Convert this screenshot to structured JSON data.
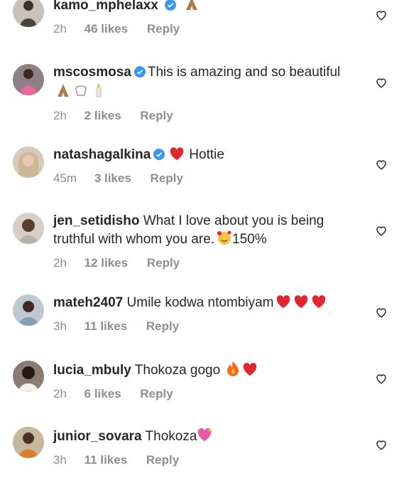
{
  "comments": [
    {
      "username": "kamo_mphelaxx",
      "verified": true,
      "text": "",
      "emoji": [
        "folded-hands"
      ],
      "time": "2h",
      "likes": "46 likes",
      "reply": "Reply"
    },
    {
      "username": "mscosmosa",
      "verified": true,
      "text": "This is amazing and so beautiful",
      "emoji": [
        "folded-hands",
        "pouch",
        "candle"
      ],
      "time": "2h",
      "likes": "2 likes",
      "reply": "Reply"
    },
    {
      "username": "natashagalkina",
      "verified": true,
      "text": "Hottie",
      "emoji": [
        "red-heart"
      ],
      "time": "45m",
      "likes": "3 likes",
      "reply": "Reply"
    },
    {
      "username": "jen_setidisho",
      "verified": false,
      "text": "What I love about you is being truthful with whom you are.",
      "text_tail": "150%",
      "emoji": [
        "smiling-face-with-hearts"
      ],
      "time": "2h",
      "likes": "12 likes",
      "reply": "Reply"
    },
    {
      "username": "mateh2407",
      "verified": false,
      "text": "Umile kodwa ntombiyam",
      "emoji": [
        "red-heart",
        "red-heart",
        "red-heart"
      ],
      "time": "3h",
      "likes": "11 likes",
      "reply": "Reply"
    },
    {
      "username": "lucia_mbuly",
      "verified": false,
      "text": "Thokoza gogo",
      "emoji": [
        "fire",
        "red-heart"
      ],
      "time": "2h",
      "likes": "6 likes",
      "reply": "Reply"
    },
    {
      "username": "junior_sovara",
      "verified": false,
      "text": "Thokoza",
      "emoji": [
        "sparkling-heart"
      ],
      "time": "3h",
      "likes": "11 likes",
      "reply": "Reply"
    }
  ],
  "colors": {
    "text": "#262626",
    "meta": "#8e8e8e",
    "verified": "#3897f0",
    "heart_outline": "#262626"
  },
  "icons": {
    "like": "heart-outline-icon",
    "verified": "verified-badge-icon"
  }
}
